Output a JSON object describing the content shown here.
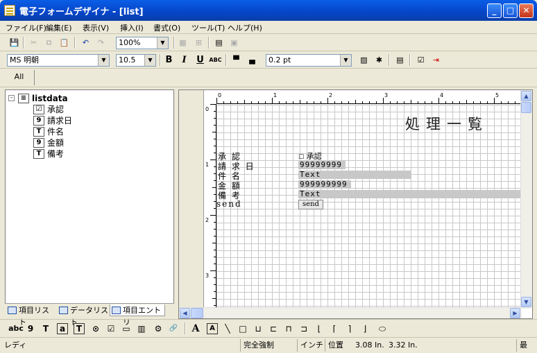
{
  "window": {
    "title": "電子フォームデザイナ - [list]"
  },
  "menu": [
    "ファイル(F)",
    "編集(E)",
    "表示(V)",
    "挿入(I)",
    "書式(O)",
    "ツール(T)",
    "ヘルプ(H)"
  ],
  "toolbar": {
    "zoom": "100%"
  },
  "formatbar": {
    "font": "MS 明朝",
    "size": "10.5",
    "bold": "B",
    "italic": "I",
    "underline": "U",
    "abc": "ABC",
    "line": "0.2 pt"
  },
  "tabs": {
    "all": "All"
  },
  "tree": {
    "root": "listdata",
    "items": [
      {
        "icon": "☑",
        "label": "承認"
      },
      {
        "icon": "9",
        "label": "請求日"
      },
      {
        "icon": "T",
        "label": "件名"
      },
      {
        "icon": "9",
        "label": "金額"
      },
      {
        "icon": "T",
        "label": "備考"
      }
    ]
  },
  "left_tabs": [
    "項目リスト",
    "データリスト",
    "項目エントリ"
  ],
  "ruler": {
    "top": [
      "0",
      "1",
      "2",
      "3",
      "4",
      "5"
    ],
    "left": [
      "0",
      "1",
      "2",
      "3"
    ]
  },
  "form": {
    "title": "処理一覧",
    "labels": [
      "承 認",
      "請 求 日",
      "件 名",
      "金 額",
      "備 考",
      "send"
    ],
    "check_label": "承認",
    "date_value": "99999999",
    "subject_value": "Text",
    "amount_value": "999999999",
    "note_value": "Text",
    "send_button": "send"
  },
  "bottom_tools": [
    "abc",
    "9",
    "T",
    "a",
    "T",
    "⊙",
    "☑",
    "▭",
    "▥",
    "⚙",
    "🔗",
    "A",
    "A",
    "╲",
    "□",
    "⊔",
    "⊏",
    "⊓",
    "⊐",
    "⌊",
    "⌈",
    "⌉",
    "⌋",
    "⬭"
  ],
  "status": {
    "state": "レディ",
    "mode": "完全強制",
    "unit": "インチ",
    "pos_label": "位置",
    "x": "3.08 In.",
    "y": "3.32 In.",
    "end": "最"
  }
}
